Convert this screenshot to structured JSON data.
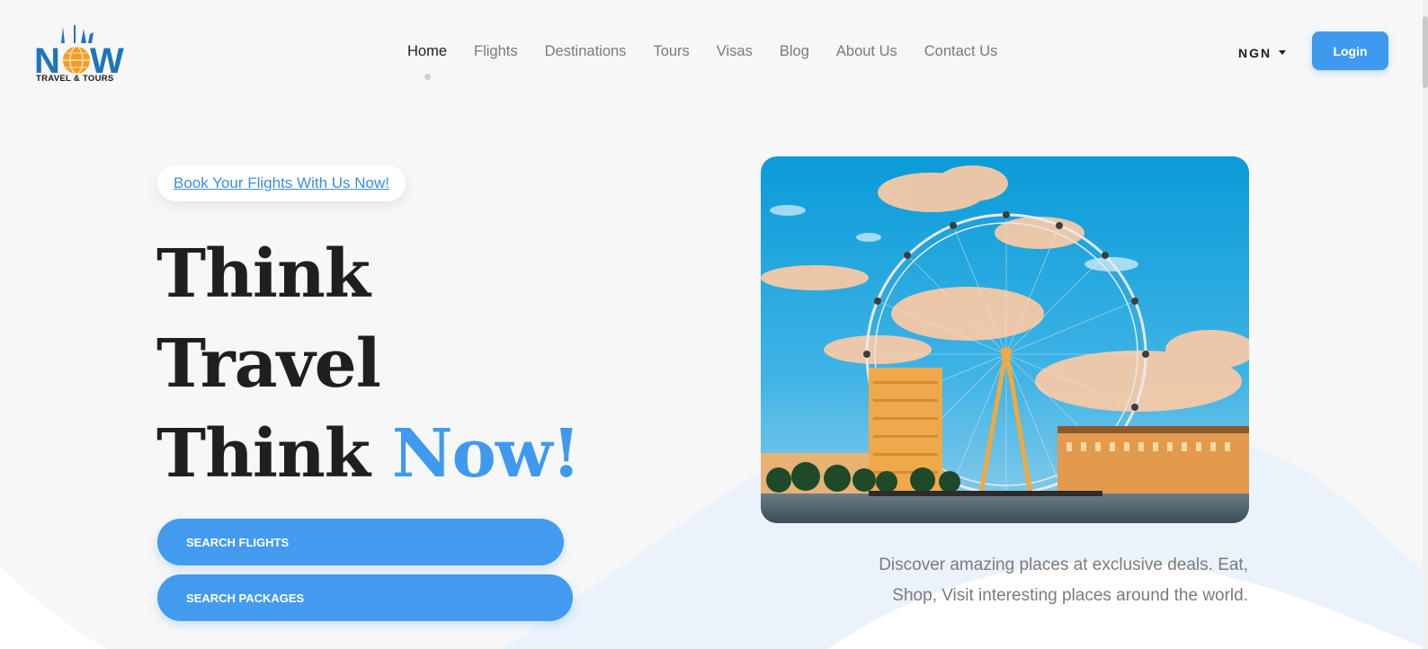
{
  "brand": {
    "logo_word": "NOW",
    "tagline": "TRAVEL & TOURS",
    "colors": {
      "primary": "#3f9aef",
      "logo_blue": "#1d75bc",
      "logo_orange": "#f39c29"
    }
  },
  "nav": {
    "items": [
      {
        "label": "Home",
        "active": true
      },
      {
        "label": "Flights",
        "active": false
      },
      {
        "label": "Destinations",
        "active": false
      },
      {
        "label": "Tours",
        "active": false
      },
      {
        "label": "Visas",
        "active": false
      },
      {
        "label": "Blog",
        "active": false
      },
      {
        "label": "About Us",
        "active": false
      },
      {
        "label": "Contact Us",
        "active": false
      }
    ]
  },
  "header": {
    "currency": "NGN",
    "login_label": "Login"
  },
  "hero": {
    "pill_link": "Book Your Flights With Us Now!",
    "headline": {
      "line1": "Think",
      "line2": "Travel",
      "line3_a": "Think ",
      "line3_accent": "Now!"
    },
    "cta_flights": "Search Flights",
    "cta_packages": "Search Packages",
    "description": "Discover amazing places at exclusive deals. Eat, Shop, Visit interesting places around the world."
  },
  "icons": {
    "currency_caret": "caret-down-icon"
  }
}
